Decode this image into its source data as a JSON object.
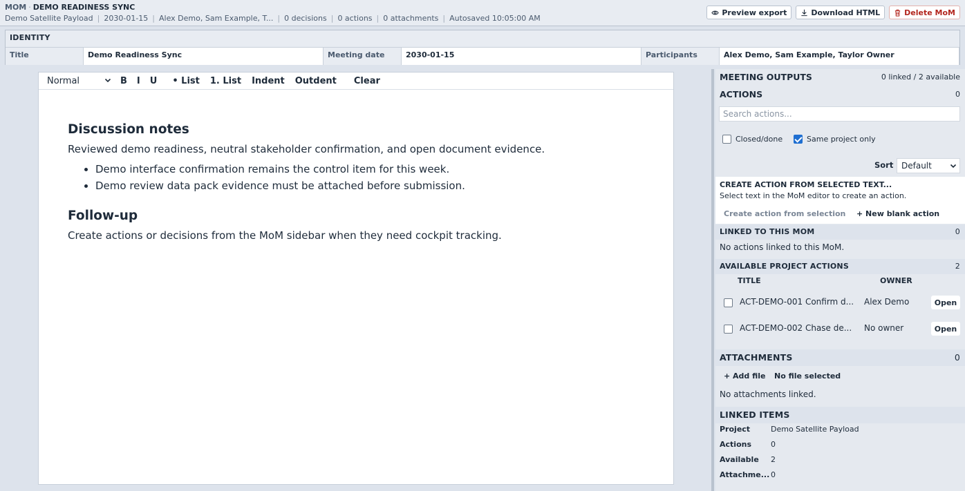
{
  "header": {
    "kind": "MOM",
    "title": "DEMO READINESS SYNC",
    "meta": [
      "Demo Satellite Payload",
      "2030-01-15",
      "Alex Demo, Sam Example, T...",
      "0 decisions",
      "0 actions",
      "0 attachments",
      "Autosaved 10:05:00 AM"
    ],
    "buttons": {
      "preview": "Preview export",
      "download": "Download HTML",
      "delete": "Delete MoM"
    }
  },
  "identity": {
    "heading": "IDENTITY",
    "fields": [
      {
        "label": "Title",
        "value": "Demo Readiness Sync"
      },
      {
        "label": "Meeting date",
        "value": "2030-01-15"
      },
      {
        "label": "Participants",
        "value": "Alex Demo, Sam Example, Taylor Owner"
      }
    ]
  },
  "editor": {
    "toolbar": {
      "style": "Normal",
      "bold": "B",
      "italic": "I",
      "underline": "U",
      "bullet": "• List",
      "numbered": "1. List",
      "indent": "Indent",
      "outdent": "Outdent",
      "clear": "Clear"
    },
    "content": {
      "h1": "Discussion notes",
      "p1": "Reviewed demo readiness, neutral stakeholder confirmation, and open document evidence.",
      "bullets": [
        "Demo interface confirmation remains the control item for this week.",
        "Demo review data pack evidence must be attached before submission."
      ],
      "h2": "Follow-up",
      "p2": "Create actions or decisions from the MoM sidebar when they need cockpit tracking."
    }
  },
  "sidebar": {
    "outputs": {
      "heading": "MEETING OUTPUTS",
      "summary": "0 linked / 2 available"
    },
    "actions": {
      "heading": "ACTIONS",
      "count": "0"
    },
    "search_placeholder": "Search actions...",
    "filters": {
      "closed": "Closed/done",
      "closed_checked": false,
      "same_project": "Same project only",
      "same_project_checked": true
    },
    "sort": {
      "label": "Sort",
      "value": "Default"
    },
    "create": {
      "heading": "CREATE ACTION FROM SELECTED TEXT...",
      "hint": "Select text in the MoM editor to create an action.",
      "from_selection": "Create action from selection",
      "new_blank": "+ New blank action"
    },
    "linked": {
      "heading": "LINKED TO THIS MOM",
      "count": "0",
      "empty": "No actions linked to this MoM."
    },
    "available": {
      "heading": "AVAILABLE PROJECT ACTIONS",
      "count": "2",
      "col_title": "TITLE",
      "col_owner": "OWNER",
      "rows": [
        {
          "title": "ACT-DEMO-001 Confirm d...",
          "owner": "Alex Demo",
          "action": "Open"
        },
        {
          "title": "ACT-DEMO-002 Chase de...",
          "owner": "No owner",
          "action": "Open"
        }
      ]
    },
    "attachments": {
      "heading": "ATTACHMENTS",
      "count": "0",
      "add": "+ Add file",
      "file_status": "No file selected",
      "empty": "No attachments linked."
    },
    "linked_items": {
      "heading": "LINKED ITEMS",
      "rows": [
        {
          "label": "Project",
          "value": "Demo Satellite Payload"
        },
        {
          "label": "Actions",
          "value": "0"
        },
        {
          "label": "Available",
          "value": "2"
        },
        {
          "label": "Attachme...",
          "value": "0"
        }
      ]
    }
  },
  "colors": {
    "accent": "#1f6fd1",
    "danger": "#b3261e",
    "background": "#dde3ec"
  }
}
